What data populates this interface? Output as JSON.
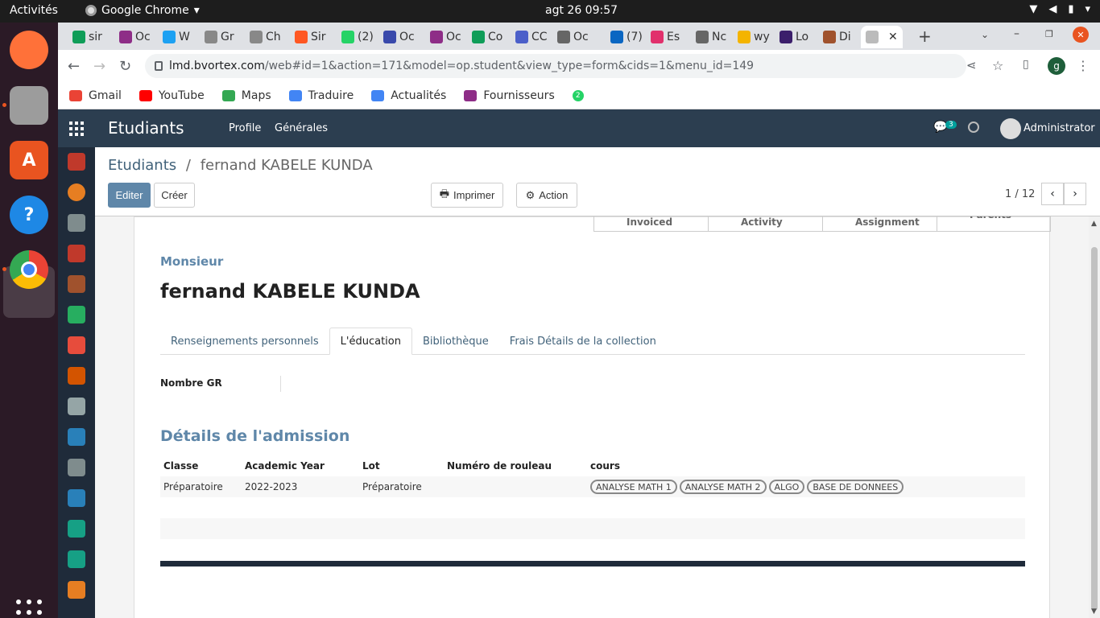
{
  "system": {
    "activities": "Activités",
    "app_name": "Google Chrome",
    "clock": "agt 26  09:57"
  },
  "chrome": {
    "tabs": [
      {
        "label": "sir",
        "color": "#0f9d58"
      },
      {
        "label": "Oc",
        "color": "#8e2d87"
      },
      {
        "label": "W",
        "color": "#1da1f2"
      },
      {
        "label": "Gr",
        "color": "#888888"
      },
      {
        "label": "Ch",
        "color": "#888888"
      },
      {
        "label": "Sir",
        "color": "#ff5722"
      },
      {
        "label": "(2)",
        "color": "#25d366"
      },
      {
        "label": "Oc",
        "color": "#3949ab"
      },
      {
        "label": "Oc",
        "color": "#8e2d87"
      },
      {
        "label": "Co",
        "color": "#0f9d58"
      },
      {
        "label": "CC",
        "color": "#4b5fc9"
      },
      {
        "label": "Oc",
        "color": "#666666"
      },
      {
        "label": "(7)",
        "color": "#0a66c2"
      },
      {
        "label": "Es",
        "color": "#e1306c"
      },
      {
        "label": "Nc",
        "color": "#666666"
      },
      {
        "label": "wy",
        "color": "#f4b400"
      },
      {
        "label": "Lo",
        "color": "#3b1e6b"
      },
      {
        "label": "Di",
        "color": "#a0522d"
      }
    ],
    "url_domain": "lmd.bvortex.com",
    "url_path": "/web#id=1&action=171&model=op.student&view_type=form&cids=1&menu_id=149",
    "profile_initial": "g"
  },
  "bookmarks": [
    {
      "label": "Gmail",
      "color": "#ea4335"
    },
    {
      "label": "YouTube",
      "color": "#ff0000"
    },
    {
      "label": "Maps",
      "color": "#34a853"
    },
    {
      "label": "Traduire",
      "color": "#4285f4"
    },
    {
      "label": "Actualités",
      "color": "#4285f4"
    },
    {
      "label": "Fournisseurs",
      "color": "#8e2d87"
    },
    {
      "label": "2",
      "color": "#25d366"
    }
  ],
  "odoo": {
    "brand": "Etudiants",
    "menu": [
      "Profile",
      "Générales"
    ],
    "chat_count": "3",
    "user": "Administrator"
  },
  "control": {
    "breadcrumb_parent": "Etudiants",
    "breadcrumb_sep": "/",
    "breadcrumb_current": "fernand KABELE KUNDA",
    "edit_label": "Editer",
    "create_label": "Créer",
    "print_label": "Imprimer",
    "action_label": "Action",
    "pager": "1 / 12"
  },
  "form": {
    "smart_buttons": [
      "Invoiced",
      "Activity",
      "Assignment",
      "Parents"
    ],
    "title": "Monsieur",
    "student_name": "fernand  KABELE  KUNDA",
    "tabs": [
      "Renseignements personnels",
      "L'éducation",
      "Bibliothèque",
      "Frais Détails de la collection"
    ],
    "gr_label": "Nombre GR",
    "admission_title": "Détails de l'admission",
    "table_headers": [
      "Classe",
      "Academic Year",
      "Lot",
      "Numéro de rouleau",
      "cours"
    ],
    "rows": [
      {
        "classe": "Préparatoire",
        "year": "2022-2023",
        "lot": "Préparatoire",
        "roll": "",
        "courses": [
          "ANALYSE MATH 1",
          "ANALYSE MATH 2",
          "ALGO",
          "BASE DE DONNEES"
        ]
      }
    ]
  }
}
